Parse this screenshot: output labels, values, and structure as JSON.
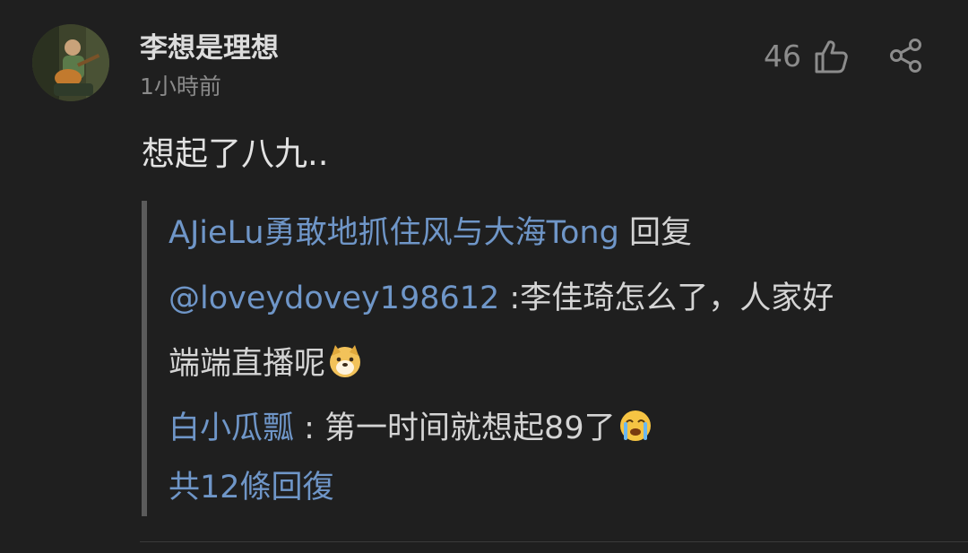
{
  "comment": {
    "username": "李想是理想",
    "timestamp": "1小時前",
    "like_count": "46",
    "body": "想起了八九.."
  },
  "replies": {
    "r1_author": "AJieLu勇敢地抓住风与大海Tong",
    "r1_action": " 回复",
    "r2_mention": "@loveydovey198612",
    "r2_text": " :李佳琦怎么了，人家好",
    "r3_text": "端端直播呢",
    "r4_author": "白小瓜瓢",
    "r4_text": " : 第一时间就想起89了",
    "more_link": "共12條回復"
  },
  "icons": {
    "like": "thumbs-up-icon",
    "share": "share-icon",
    "doge_emoji": "doge-emoji-icon",
    "crying_emoji": "crying-emoji-icon"
  },
  "colors": {
    "background": "#1f1f1f",
    "link": "#6f96c8",
    "muted": "#8a8a8a"
  }
}
